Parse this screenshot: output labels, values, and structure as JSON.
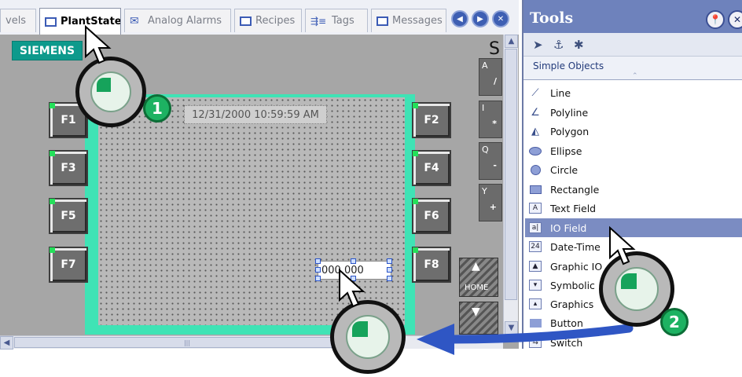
{
  "tabs": [
    {
      "label": "vels",
      "icon": "none"
    },
    {
      "label": "PlantState",
      "icon": "screen-icon",
      "active": true
    },
    {
      "label": "Analog Alarms",
      "icon": "alarm-icon"
    },
    {
      "label": "Recipes",
      "icon": "screen-icon"
    },
    {
      "label": "Tags",
      "icon": "tags-icon"
    },
    {
      "label": "Messages",
      "icon": "screen-icon"
    }
  ],
  "nav": {
    "prev": "◀",
    "next": "▶",
    "close": "✕"
  },
  "editor": {
    "brand": "SIEMENS",
    "corner_letter": "S",
    "datetime": "12/31/2000 10:59:59 AM",
    "io_field_value": "000.000",
    "function_keys": [
      "F1",
      "F2",
      "F3",
      "F4",
      "F5",
      "F6",
      "F7",
      "F8"
    ],
    "side_keys": [
      {
        "key": "A",
        "op": "/"
      },
      {
        "key": "I",
        "op": "*"
      },
      {
        "key": "Q",
        "op": "-"
      },
      {
        "key": "Y",
        "op": "+"
      }
    ],
    "home_key": "HOME",
    "hscroll_grip": "|||"
  },
  "tools": {
    "title": "Tools",
    "section": "Simple Objects",
    "items": [
      {
        "label": "Line",
        "icon": "line-icon"
      },
      {
        "label": "Polyline",
        "icon": "polyline-icon"
      },
      {
        "label": "Polygon",
        "icon": "polygon-icon"
      },
      {
        "label": "Ellipse",
        "icon": "ellipse-icon"
      },
      {
        "label": "Circle",
        "icon": "circle-icon"
      },
      {
        "label": "Rectangle",
        "icon": "rectangle-icon"
      },
      {
        "label": "Text Field",
        "icon": "text-field-icon"
      },
      {
        "label": "IO Field",
        "icon": "io-field-icon",
        "selected": true
      },
      {
        "label": "Date-Time",
        "icon": "date-time-icon"
      },
      {
        "label": "Graphic IO",
        "icon": "graphic-io-icon"
      },
      {
        "label": "Symbolic",
        "icon": "symbolic-icon"
      },
      {
        "label": "Graphics",
        "icon": "graphics-icon"
      },
      {
        "label": "Button",
        "icon": "button-icon"
      },
      {
        "label": "Switch",
        "icon": "switch-icon"
      }
    ]
  },
  "annotations": {
    "step1": "1",
    "step2": "2"
  },
  "colors": {
    "frame": "#3fe3b5",
    "brand": "#0d9a8c",
    "tools_header": "#6e82bc",
    "selected_item": "#7b8cc2",
    "badge": "#1db262",
    "arrow": "#2f56c4"
  }
}
